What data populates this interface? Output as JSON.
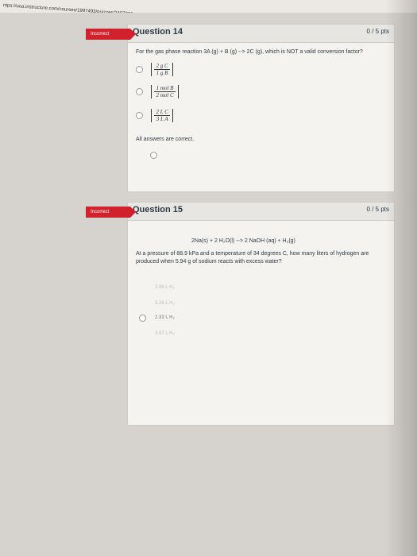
{
  "browser": {
    "url": "ntps://uoa.instructure.com/courses/1997493/quizzes/2407808"
  },
  "q14": {
    "flag": "Incorrect",
    "title": "Question 14",
    "points": "0 / 5 pts",
    "prompt": "For the gas phase reaction 3A (g) + B (g) --> 2C (g), which is NOT a valid conversion factor?",
    "options": [
      {
        "num": "2 g C",
        "den": "1 g B"
      },
      {
        "num": "1 mol B",
        "den": "2 mol C"
      },
      {
        "num": "2 L C",
        "den": "3 L A"
      }
    ],
    "all_correct": "All answers are correct."
  },
  "q15": {
    "flag": "Incorrect",
    "title": "Question 15",
    "points": "0 / 5 pts",
    "equation": "2Na(s) + 2 H₂O(l) --> 2 NaOH (aq) + H₂(g)",
    "prompt": "At a pressure of 88.9 kPa and a temperature of 34 degrees C, how many liters of hydrogen are produced when 5.94 g of sodium reacts with excess water?",
    "answers": [
      "2.98 L H₂",
      "3.26 L H₂",
      "2.33 L H₂",
      "3.97 L H₂"
    ]
  }
}
